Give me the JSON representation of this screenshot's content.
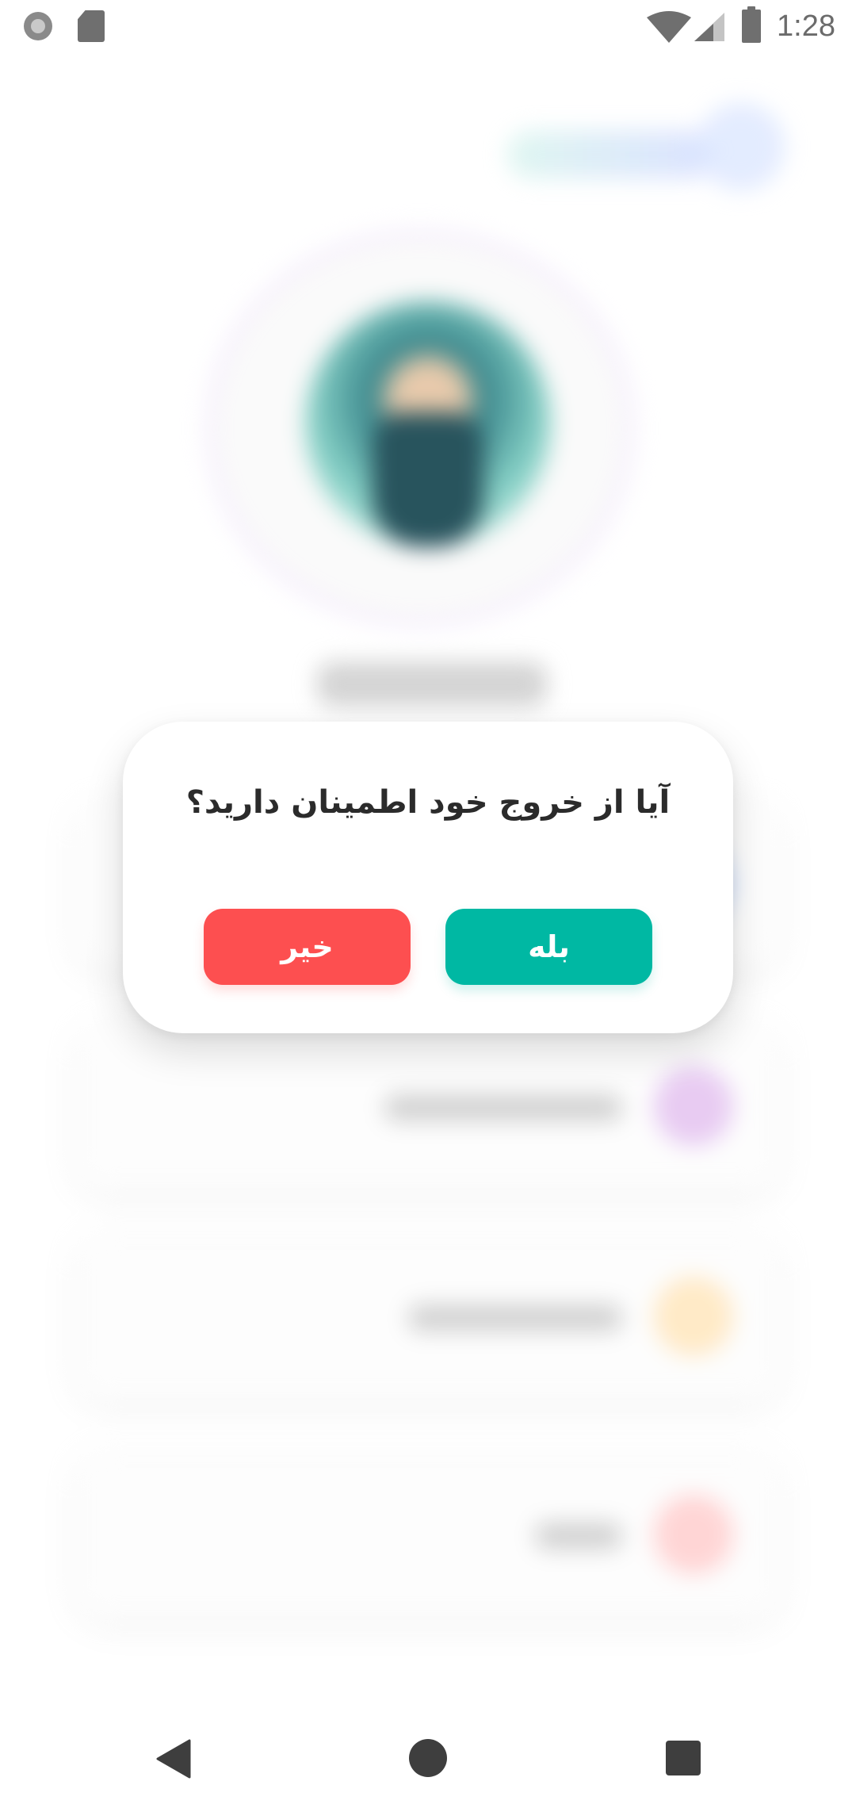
{
  "status_bar": {
    "time": "1:28",
    "icons": [
      "record-icon",
      "sd-card-icon",
      "wifi-icon",
      "cell-signal-icon",
      "battery-icon"
    ]
  },
  "dialog": {
    "question": "آیا از خروج خود اطمینان دارید؟",
    "confirm_label": "بله",
    "cancel_label": "خیر"
  },
  "nav_bar": {
    "icons": [
      "back-icon",
      "home-icon",
      "recents-icon"
    ]
  },
  "colors": {
    "confirm": "#00b8a3",
    "cancel": "#fd4f50",
    "text": "#2b2b2b",
    "background": "#ffffff"
  }
}
